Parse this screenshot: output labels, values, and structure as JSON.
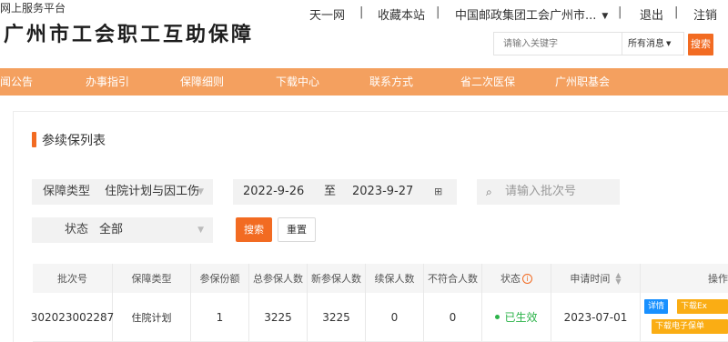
{
  "header": {
    "logo_text": "广州市工会职工互助保障",
    "top_links": [
      "天一网",
      "收藏本站",
      "中国邮政集团工会广州市...",
      "退出",
      "注销"
    ],
    "separator": "|",
    "search_placeholder": "请输入关键字",
    "search_scope": "所有消息",
    "search_button": "搜索"
  },
  "nav": {
    "items": [
      "闻公告",
      "办事指引",
      "保障细则",
      "下载中心",
      "联系方式",
      "省二次医保",
      "广州职基会"
    ],
    "active": "网上服务平台",
    "color": "#f4a05f",
    "active_color": "#ec5c17"
  },
  "section": {
    "title": "参续保列表"
  },
  "filters": {
    "type_label": "保障类型",
    "type_value": "住院计划与因工伤",
    "date_start": "2022-9-26",
    "date_sep": "至",
    "date_end": "2023-9-27",
    "batch_placeholder": "请输入批次号",
    "status_label": "状态",
    "status_value": "全部",
    "search_button": "搜索",
    "reset_button": "重置"
  },
  "table": {
    "headers": [
      "批次号",
      "保障类型",
      "参保份额",
      "总参保人数",
      "新参保人数",
      "续保人数",
      "不符合人数",
      "状态",
      "申请时间",
      "操作"
    ],
    "rows": [
      {
        "batch_no": "302023002287",
        "type": "住院计划",
        "share": "1",
        "total": "3225",
        "new": "3225",
        "renew": "0",
        "unqualified": "0",
        "status": "已生效",
        "date": "2023-07-01",
        "actions": [
          "详情",
          "下载Ex",
          "下载电子保单"
        ]
      }
    ]
  },
  "colors": {
    "accent": "#f26b22",
    "status_green": "#2cb34a",
    "detail_blue": "#1890ff",
    "download_orange": "#faad14"
  }
}
